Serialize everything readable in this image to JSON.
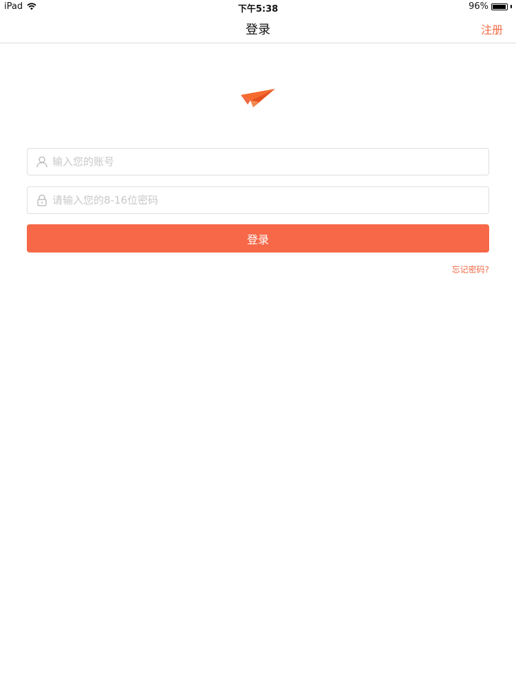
{
  "status_bar": {
    "device": "iPad",
    "time": "下午5:38",
    "battery_text": "96%",
    "battery_level": 0.96
  },
  "nav": {
    "title": "登录",
    "register_label": "注册"
  },
  "form": {
    "account_placeholder": "输入您的账号",
    "password_placeholder": "请输入您的8-16位密码",
    "login_label": "登录",
    "forgot_label": "忘记密码?"
  },
  "colors": {
    "accent": "#f76848",
    "link": "#f06a45"
  },
  "icons": {
    "logo": "paper-plane-icon",
    "account": "user-icon",
    "password": "lock-icon"
  }
}
